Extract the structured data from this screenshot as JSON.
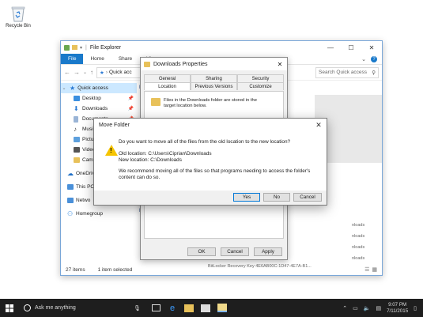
{
  "desktop": {
    "recycle_bin_label": "Recycle Bin"
  },
  "explorer": {
    "title": "File Explorer",
    "window_controls": {
      "minimize": "—",
      "maximize": "☐",
      "close": "✕"
    },
    "ribbon_tabs": [
      "File",
      "Home",
      "Share",
      "Vie"
    ],
    "address_path": "Quick acc",
    "search_placeholder": "Search Quick access",
    "nav_items": [
      {
        "label": "Quick access",
        "icon": "star-icon",
        "color": "#2a7ad4",
        "pinned": false
      },
      {
        "label": "Desktop",
        "icon": "desktop-icon",
        "color": "#3a8fe0",
        "pinned": true
      },
      {
        "label": "Downloads",
        "icon": "download-icon",
        "color": "#2a7ad4",
        "pinned": true
      },
      {
        "label": "Documents",
        "icon": "document-icon",
        "color": "#9ab4d6",
        "pinned": true
      },
      {
        "label": "Music",
        "icon": "music-icon",
        "color": "#444444",
        "pinned": false
      },
      {
        "label": "Pictur",
        "icon": "pictures-icon",
        "color": "#5da0dd",
        "pinned": false
      },
      {
        "label": "Video",
        "icon": "video-icon",
        "color": "#555555",
        "pinned": false
      },
      {
        "label": "Came",
        "icon": "folder-icon",
        "color": "#e8c15a",
        "pinned": false
      },
      {
        "label": "OneDriv",
        "icon": "onedrive-icon",
        "color": "#1f6fc6",
        "pinned": false
      },
      {
        "label": "This PC",
        "icon": "computer-icon",
        "color": "#4a90d9",
        "pinned": false
      },
      {
        "label": "Netwo",
        "icon": "network-icon",
        "color": "#4a90d9",
        "pinned": false
      },
      {
        "label": "Homegroup",
        "icon": "homegroup-icon",
        "color": "#2e86de",
        "pinned": false
      }
    ],
    "content_fragments": [
      "Fr",
      "R",
      "nloads",
      "nloads",
      "nloads",
      "nloads",
      "BitLocker Recovery Key 4E6AB00C-1D47-4E7A-B1..."
    ],
    "status": {
      "items": "27 items",
      "selected": "1 item selected"
    }
  },
  "properties_dialog": {
    "title": "Downloads Properties",
    "tabs_row1": [
      "General",
      "Sharing",
      "Security"
    ],
    "tabs_row2": [
      "Location",
      "Previous Versions",
      "Customize"
    ],
    "message": "Files in the Downloads folder are stored in the target location below.",
    "buttons": {
      "ok": "OK",
      "cancel": "Cancel",
      "apply": "Apply"
    }
  },
  "move_folder_dialog": {
    "title": "Move Folder",
    "question": "Do you want to move all of the files from the old location to the new location?",
    "old_location": "Old location: C:\\Users\\Ciprian\\Downloads",
    "new_location": "New location: C:\\Downloads",
    "recommendation": "We recommend moving all of the files so that programs needing to access the folder's content can do so.",
    "buttons": {
      "yes": "Yes",
      "no": "No",
      "cancel": "Cancel"
    }
  },
  "taskbar": {
    "search_placeholder": "Ask me anything",
    "time": "9:07 PM",
    "date": "7/11/2015"
  }
}
